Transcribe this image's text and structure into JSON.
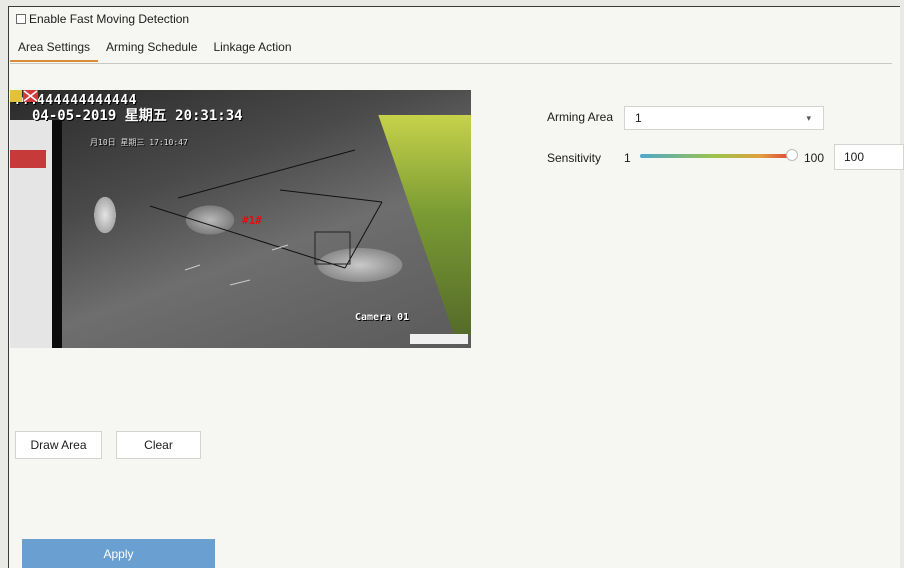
{
  "enable": {
    "label": "Enable Fast Moving Detection",
    "checked": false
  },
  "tabs": [
    {
      "label": "Area Settings",
      "active": true
    },
    {
      "label": "Arming Schedule",
      "active": false
    },
    {
      "label": "Linkage Action",
      "active": false
    }
  ],
  "preview": {
    "osd_top": "444444444444444",
    "osd_datetime": "04-05-2019 星期五 20:31:34",
    "osd_inner_time": "月10日 星期三 17:10:47",
    "camera_label": "Camera 01",
    "zone_marker": "#1#"
  },
  "settings": {
    "arming_area_label": "Arming Area",
    "arming_area_value": "1",
    "sensitivity_label": "Sensitivity",
    "sensitivity_min": "1",
    "sensitivity_max": "100",
    "sensitivity_value": "100"
  },
  "buttons": {
    "draw_area": "Draw Area",
    "clear": "Clear",
    "apply": "Apply"
  },
  "colors": {
    "accent_tab": "#d98f3a",
    "apply_bg": "#6a9fd1"
  }
}
